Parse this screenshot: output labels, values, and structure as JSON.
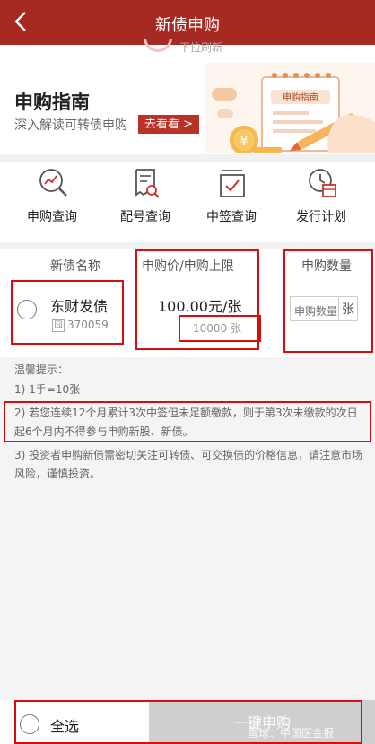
{
  "nav": {
    "title": "新债申购",
    "back_icon": "chevron-left-icon"
  },
  "pull_hint": {
    "text": "下拉刷新"
  },
  "banner": {
    "title": "申购指南",
    "subtitle": "深入解读可转债申购",
    "button": "去看看 >",
    "clipboard_label": "申购指南",
    "coin_symbol": "¥"
  },
  "menu": [
    {
      "label": "申购查询",
      "icon": "search-chart-icon"
    },
    {
      "label": "配号查询",
      "icon": "receipt-search-icon"
    },
    {
      "label": "中签查询",
      "icon": "checkbox-icon"
    },
    {
      "label": "发行计划",
      "icon": "clock-calendar-icon"
    }
  ],
  "table": {
    "headers": {
      "name": "新债名称",
      "price": "申购价/申购上限",
      "qty": "申购数量"
    },
    "row": {
      "name": "东财发债",
      "tag": "囧",
      "code": "370059",
      "price": "100.00元/张",
      "limit": "10000 张",
      "qty_placeholder": "申购数量",
      "qty_unit": "张"
    }
  },
  "notes": {
    "title": "温馨提示：",
    "items": [
      "1) 1手=10张",
      "2) 若您连续12个月累计3次中签但未足额缴款，则于第3次未缴款的次日起6个月内不得参与申购新股、新债。",
      "3) 投资者申购新债需密切关注可转债、可交换债的价格信息，请注意市场风险，谨慎投资。"
    ]
  },
  "bottom": {
    "select_all": "全选",
    "submit": "一键申购"
  },
  "watermark": "雪球：中国医金报",
  "colors": {
    "nav": "#a62a22",
    "button": "#b8322a",
    "annotation": "#d80e0e",
    "submit_disabled": "#cfcfcf"
  }
}
